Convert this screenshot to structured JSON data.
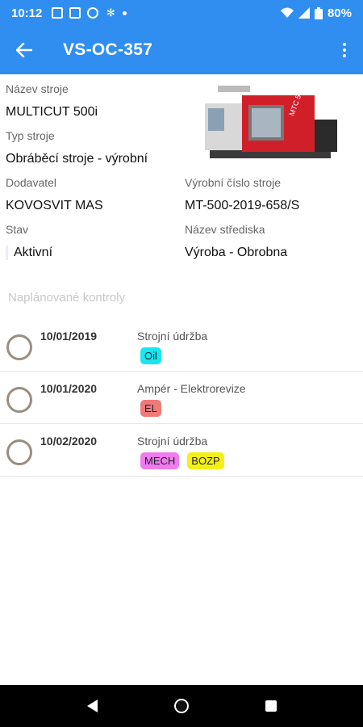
{
  "status_bar": {
    "time": "10:12",
    "battery": "80%"
  },
  "app_bar": {
    "title": "VS-OC-357",
    "back_icon": "arrow-back-icon",
    "menu_icon": "more-vert-icon"
  },
  "machine": {
    "name_label": "Název stroje",
    "name_value": "MULTICUT 500i",
    "type_label": "Typ stroje",
    "type_value": "Obráběcí stroje - výrobní",
    "supplier_label": "Dodavatel",
    "supplier_value": "KOVOSVIT MAS",
    "serial_label": "Výrobní číslo stroje",
    "serial_value": "MT-500-2019-658/S",
    "state_label": "Stav",
    "state_value": "Aktivní",
    "center_label": "Název střediska",
    "center_value": "Výroba - Obrobna",
    "image_text": "MTC 500"
  },
  "inspections": {
    "section_title": "Naplánované kontroly",
    "rows": [
      {
        "date": "10/01/2019",
        "type": "Strojní údržba",
        "tags": [
          {
            "label": "Oil",
            "color": "#19e6f0"
          }
        ]
      },
      {
        "date": "10/01/2020",
        "type": "Ampér - Elektrorevize",
        "tags": [
          {
            "label": "EL",
            "color": "#f07a7a"
          }
        ]
      },
      {
        "date": "10/02/2020",
        "type": "Strojní údržba",
        "tags": [
          {
            "label": "MECH",
            "color": "#f07af0"
          },
          {
            "label": "BOZP",
            "color": "#f5f014"
          }
        ]
      }
    ]
  },
  "colors": {
    "primary": "#2f8ef0"
  }
}
